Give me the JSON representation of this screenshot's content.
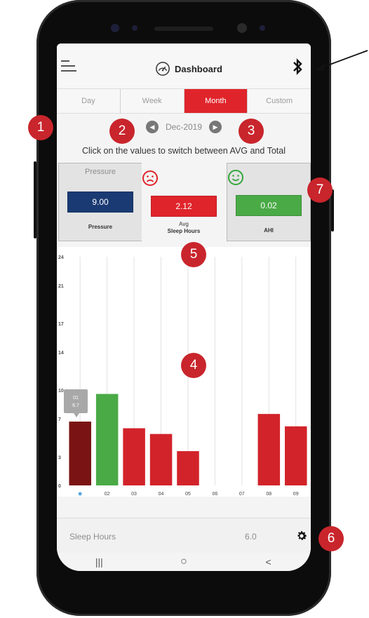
{
  "header": {
    "title": "Dashboard",
    "menu_icon": "hamburger-icon",
    "gauge_icon": "gauge-icon",
    "bluetooth_icon": "bluetooth-icon"
  },
  "tabs": [
    {
      "label": "Day",
      "active": false
    },
    {
      "label": "Week",
      "active": false
    },
    {
      "label": "Month",
      "active": true
    },
    {
      "label": "Custom",
      "active": false
    }
  ],
  "period": {
    "label": "Dec-2019",
    "prev_icon": "chevron-left-icon",
    "next_icon": "chevron-right-icon"
  },
  "hint": "Click on the values to switch between AVG and Total",
  "cards": {
    "pressure": {
      "head": "Pressure",
      "value": "9.00",
      "foot": "Pressure",
      "color": "#1a3a73"
    },
    "sleep": {
      "face": "sad-face-icon",
      "value": "2.12",
      "foot_line1": "Avg",
      "foot_line2": "Sleep Hours",
      "color": "#e0242b"
    },
    "ahi": {
      "face": "happy-face-icon",
      "value": "0.02",
      "foot": "AHI",
      "color": "#4aaa46"
    }
  },
  "chart_data": {
    "type": "bar",
    "categories": [
      "01",
      "02",
      "03",
      "04",
      "05",
      "06",
      "07",
      "08",
      "09"
    ],
    "values": [
      6.7,
      9.6,
      6.0,
      5.4,
      3.6,
      0,
      0,
      7.5,
      6.2
    ],
    "colors": [
      "#7a1414",
      "#4aaa46",
      "#d2232a",
      "#d2232a",
      "#d2232a",
      "#d2232a",
      "#d2232a",
      "#d2232a",
      "#d2232a"
    ],
    "yticks": [
      "0",
      "3",
      "7",
      "10",
      "14",
      "17",
      "21",
      "24"
    ],
    "ylim": [
      0,
      24
    ],
    "x_labels_shown": [
      "02",
      "03",
      "04",
      "05",
      "06",
      "07",
      "08",
      "09"
    ],
    "tooltip": {
      "line1": "01",
      "line2": "6.7"
    },
    "grid": true
  },
  "bottom": {
    "label": "Sleep Hours",
    "value": "6.0",
    "settings_icon": "gear-icon"
  },
  "navbar": {
    "recent": "|||",
    "home": "○",
    "back": "<"
  },
  "callouts": [
    "1",
    "2",
    "3",
    "4",
    "5",
    "6",
    "7"
  ]
}
